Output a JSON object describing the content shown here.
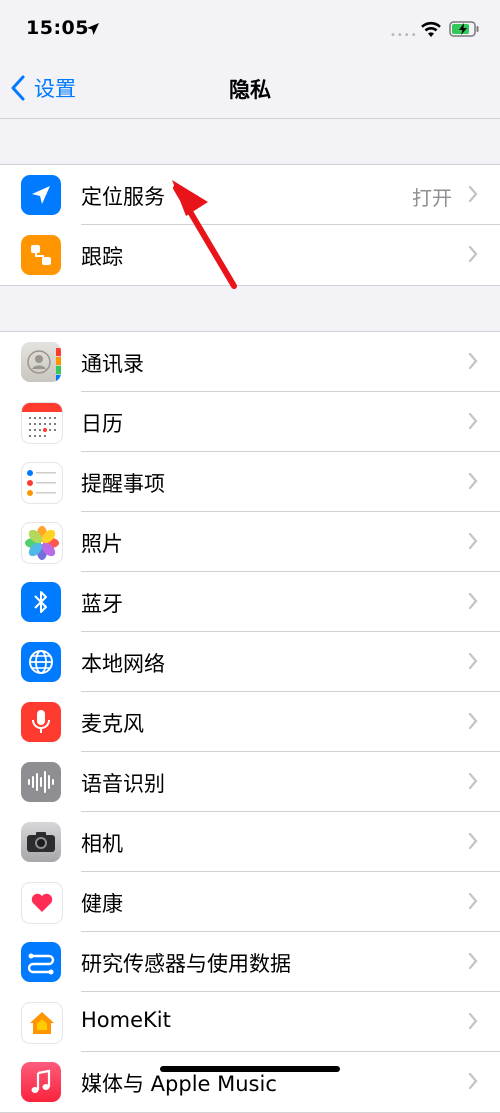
{
  "status_bar": {
    "time": "15:05",
    "signal": "••••",
    "icons": [
      "location-arrow-icon",
      "wifi-icon",
      "battery-charging-icon"
    ]
  },
  "nav": {
    "back_label": "设置",
    "title": "隐私"
  },
  "group1": [
    {
      "label": "定位服务",
      "value": "打开",
      "icon": "location-icon"
    },
    {
      "label": "跟踪",
      "value": "",
      "icon": "tracking-icon"
    }
  ],
  "group2": [
    {
      "label": "通讯录",
      "icon": "contacts-icon"
    },
    {
      "label": "日历",
      "icon": "calendar-icon"
    },
    {
      "label": "提醒事项",
      "icon": "reminders-icon"
    },
    {
      "label": "照片",
      "icon": "photos-icon"
    },
    {
      "label": "蓝牙",
      "icon": "bluetooth-icon"
    },
    {
      "label": "本地网络",
      "icon": "local-network-icon"
    },
    {
      "label": "麦克风",
      "icon": "microphone-icon"
    },
    {
      "label": "语音识别",
      "icon": "speech-recognition-icon"
    },
    {
      "label": "相机",
      "icon": "camera-icon"
    },
    {
      "label": "健康",
      "icon": "health-icon"
    },
    {
      "label": "研究传感器与使用数据",
      "icon": "research-icon"
    },
    {
      "label": "HomeKit",
      "icon": "homekit-icon"
    },
    {
      "label": "媒体与 Apple Music",
      "icon": "music-icon"
    }
  ],
  "colors": {
    "accent": "#007aff",
    "annotation_arrow": "#e8141a"
  }
}
